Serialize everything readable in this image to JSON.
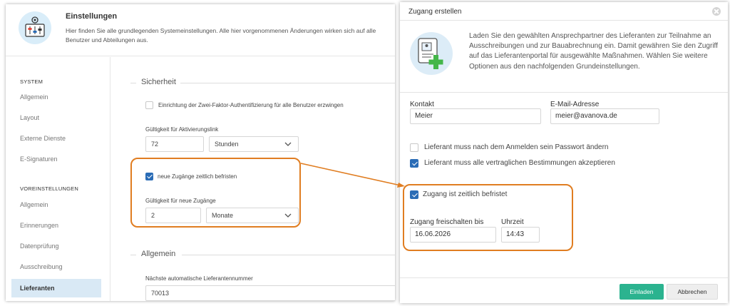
{
  "settings": {
    "title": "Einstellungen",
    "description": "Hier finden Sie alle grundlegenden Systemeinstellungen. Alle hier vorgenommenen Änderungen wirken sich auf alle Benutzer und Abteilungen aus.",
    "sidebar": {
      "system_heading": "SYSTEM",
      "system_items": [
        "Allgemein",
        "Layout",
        "Externe Dienste",
        "E-Signaturen"
      ],
      "defaults_heading": "VOREINSTELLUNGEN",
      "defaults_items": [
        "Allgemein",
        "Erinnerungen",
        "Datenprüfung",
        "Ausschreibung",
        "Lieferanten"
      ],
      "active_item": "Lieferanten"
    },
    "security": {
      "legend": "Sicherheit",
      "two_factor_label": "Einrichtung der Zwei-Faktor-Authentifizierung für alle Benutzer erzwingen",
      "two_factor_checked": false,
      "activation_validity_label": "Gültigkeit für Aktivierungslink",
      "activation_validity_value": "72",
      "activation_validity_unit": "Stunden",
      "limit_checkbox_label": "neue Zugänge zeitlich befristen",
      "limit_checked": true,
      "new_access_validity_label": "Gültigkeit für neue Zugänge",
      "new_access_validity_value": "2",
      "new_access_validity_unit": "Monate"
    },
    "general": {
      "legend": "Allgemein",
      "next_supplier_number_label": "Nächste automatische Lieferantennummer",
      "next_supplier_number_value": "70013"
    }
  },
  "dialog": {
    "title": "Zugang erstellen",
    "intro": "Laden Sie den gewählten Ansprechpartner des Lieferanten zur Teilnahme an Ausschreibungen und zur Bauabrechnung ein. Damit gewähren Sie den Zugriff auf das Lieferantenportal für ausgewählte Maßnahmen. Wählen Sie weitere Optionen aus den nachfolgenden Grundeinstellungen.",
    "contact_label": "Kontakt",
    "contact_value": "Meier",
    "email_label": "E-Mail-Adresse",
    "email_value": "meier@avanova.de",
    "option_change_password": "Lieferant muss nach dem Anmelden sein Passwort ändern",
    "option_change_password_checked": false,
    "option_accept_terms": "Lieferant muss alle vertraglichen Bestimmungen akzeptieren",
    "option_accept_terms_checked": true,
    "option_time_limited": "Zugang ist zeitlich befristet",
    "option_time_limited_checked": true,
    "unlock_until_label": "Zugang freischalten bis",
    "unlock_until_value": "16.06.2026",
    "time_label": "Uhrzeit",
    "time_value": "14:43",
    "invite_button": "Einladen",
    "cancel_button": "Abbrechen"
  },
  "colors": {
    "highlight": "#e07d21",
    "primary_button": "#2bb38f",
    "checkbox": "#2a6cb6",
    "active_sidebar": "#d9e9f5"
  },
  "icons": [
    "settings-panel-icon",
    "certificate-add-icon",
    "chevron-down-icon",
    "close-icon",
    "arrow-connector"
  ]
}
